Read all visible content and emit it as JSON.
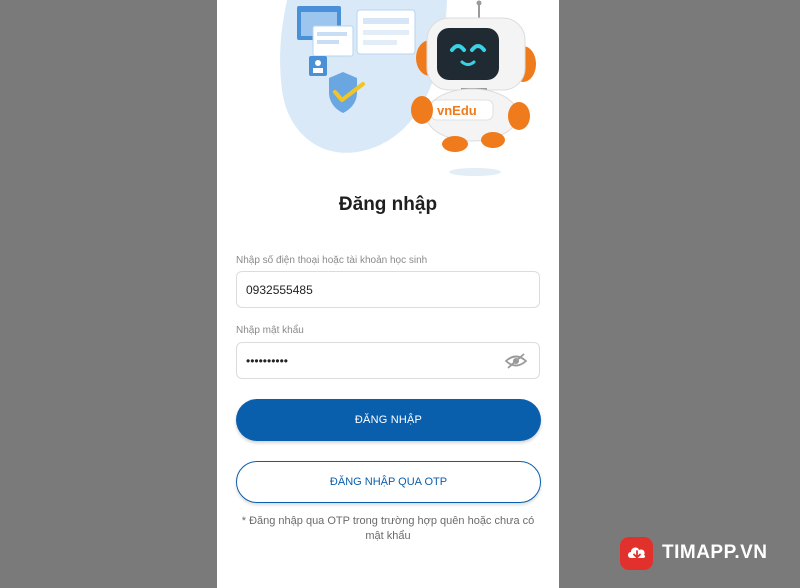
{
  "brand": {
    "mascot_text": "vnEdu"
  },
  "page": {
    "title": "Đăng nhập"
  },
  "form": {
    "account_label": "Nhập số điện thoại hoặc tài khoản học sinh",
    "account_value": "0932555485",
    "password_label": "Nhập mật khẩu",
    "password_value": "••••••••••",
    "password_toggle_icon": "eye-slash-icon"
  },
  "buttons": {
    "login": "ĐĂNG NHẬP",
    "login_otp": "ĐĂNG NHẬP QUA OTP"
  },
  "note": "* Đăng nhập qua OTP trong trường hợp quên hoặc chưa có mật khẩu",
  "watermark": {
    "text": "TIMAPP.VN",
    "icon": "cloud-download-icon"
  },
  "colors": {
    "primary": "#0a5fad",
    "accent_orange": "#f07b1d",
    "watermark_red": "#e2312d"
  }
}
